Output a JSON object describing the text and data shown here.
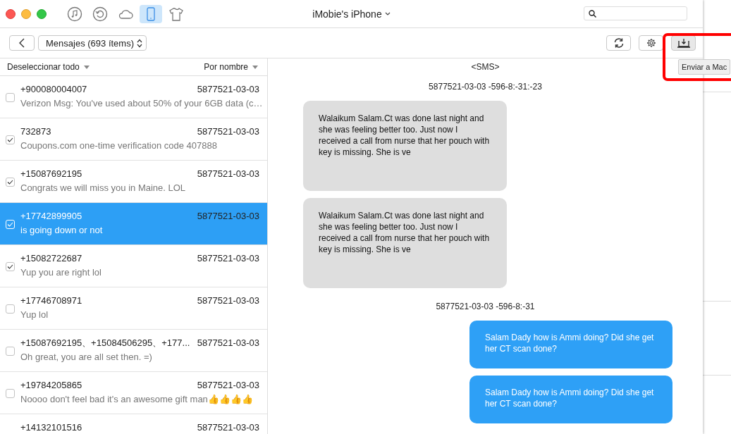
{
  "window": {
    "title": "iMobie's iPhone"
  },
  "nav_tabs": [
    {
      "kind": "music",
      "selected": false
    },
    {
      "kind": "restore",
      "selected": false
    },
    {
      "kind": "cloud",
      "selected": false
    },
    {
      "kind": "phone",
      "selected": true
    },
    {
      "kind": "shirt",
      "selected": false
    }
  ],
  "toolbar": {
    "category": "Mensajes (693 ítems)",
    "tooltip": "Enviar a Mac"
  },
  "list_header": {
    "select_action": "Deseleccionar todo",
    "sort": "Por nombre"
  },
  "items": [
    {
      "contact": "+900080004007",
      "date": "5877521-03-03",
      "preview": "Verizon Msg: You've used about 50% of your 6GB data (c…",
      "checked": false,
      "selected": false
    },
    {
      "contact": "732873",
      "date": "5877521-03-03",
      "preview": "Coupons.com one-time verification code 407888",
      "checked": true,
      "selected": false
    },
    {
      "contact": "+15087692195",
      "date": "5877521-03-03",
      "preview": "Congrats we will miss you in Maine. LOL",
      "checked": true,
      "selected": false
    },
    {
      "contact": "+17742899905",
      "date": "5877521-03-03",
      "preview": " is going down or not",
      "checked": true,
      "selected": true
    },
    {
      "contact": "+15082722687",
      "date": "5877521-03-03",
      "preview": "Yup you are right lol",
      "checked": true,
      "selected": false
    },
    {
      "contact": "+17746708971",
      "date": "5877521-03-03",
      "preview": "Yup lol",
      "checked": false,
      "selected": false
    },
    {
      "contact": "+15087692195、+15084506295、+177...",
      "date": "5877521-03-03",
      "preview": "Oh great, you are all set then. =)",
      "checked": false,
      "selected": false
    },
    {
      "contact": "+19784205865",
      "date": "5877521-03-03",
      "preview": "Noooo don't feel bad it's an awesome gift man👍👍👍👍",
      "checked": false,
      "selected": false
    },
    {
      "contact": "+14132101516",
      "date": "5877521-03-03",
      "selected": false
    }
  ],
  "conversation": {
    "header": "<SMS>",
    "entries": [
      {
        "kind": "timestamp",
        "text": "5877521-03-03 -596-8:-31:-23"
      },
      {
        "kind": "received",
        "text": "Walaikum Salam.Ct was done last night and she was feeling better too. Just now I received a call from nurse that her pouch with key is missing. She is ve"
      },
      {
        "kind": "received",
        "text": "Walaikum Salam.Ct was done last night and she was feeling better too. Just now I received a call from nurse that her pouch with key is missing. She is ve"
      },
      {
        "kind": "timestamp",
        "text": "5877521-03-03 -596-8:-31"
      },
      {
        "kind": "sent",
        "text": "Salam Dady how is Ammi doing? Did she get her CT scan done?"
      },
      {
        "kind": "sent",
        "text": "Salam Dady how is Ammi doing? Did she get her CT scan done?"
      }
    ]
  }
}
